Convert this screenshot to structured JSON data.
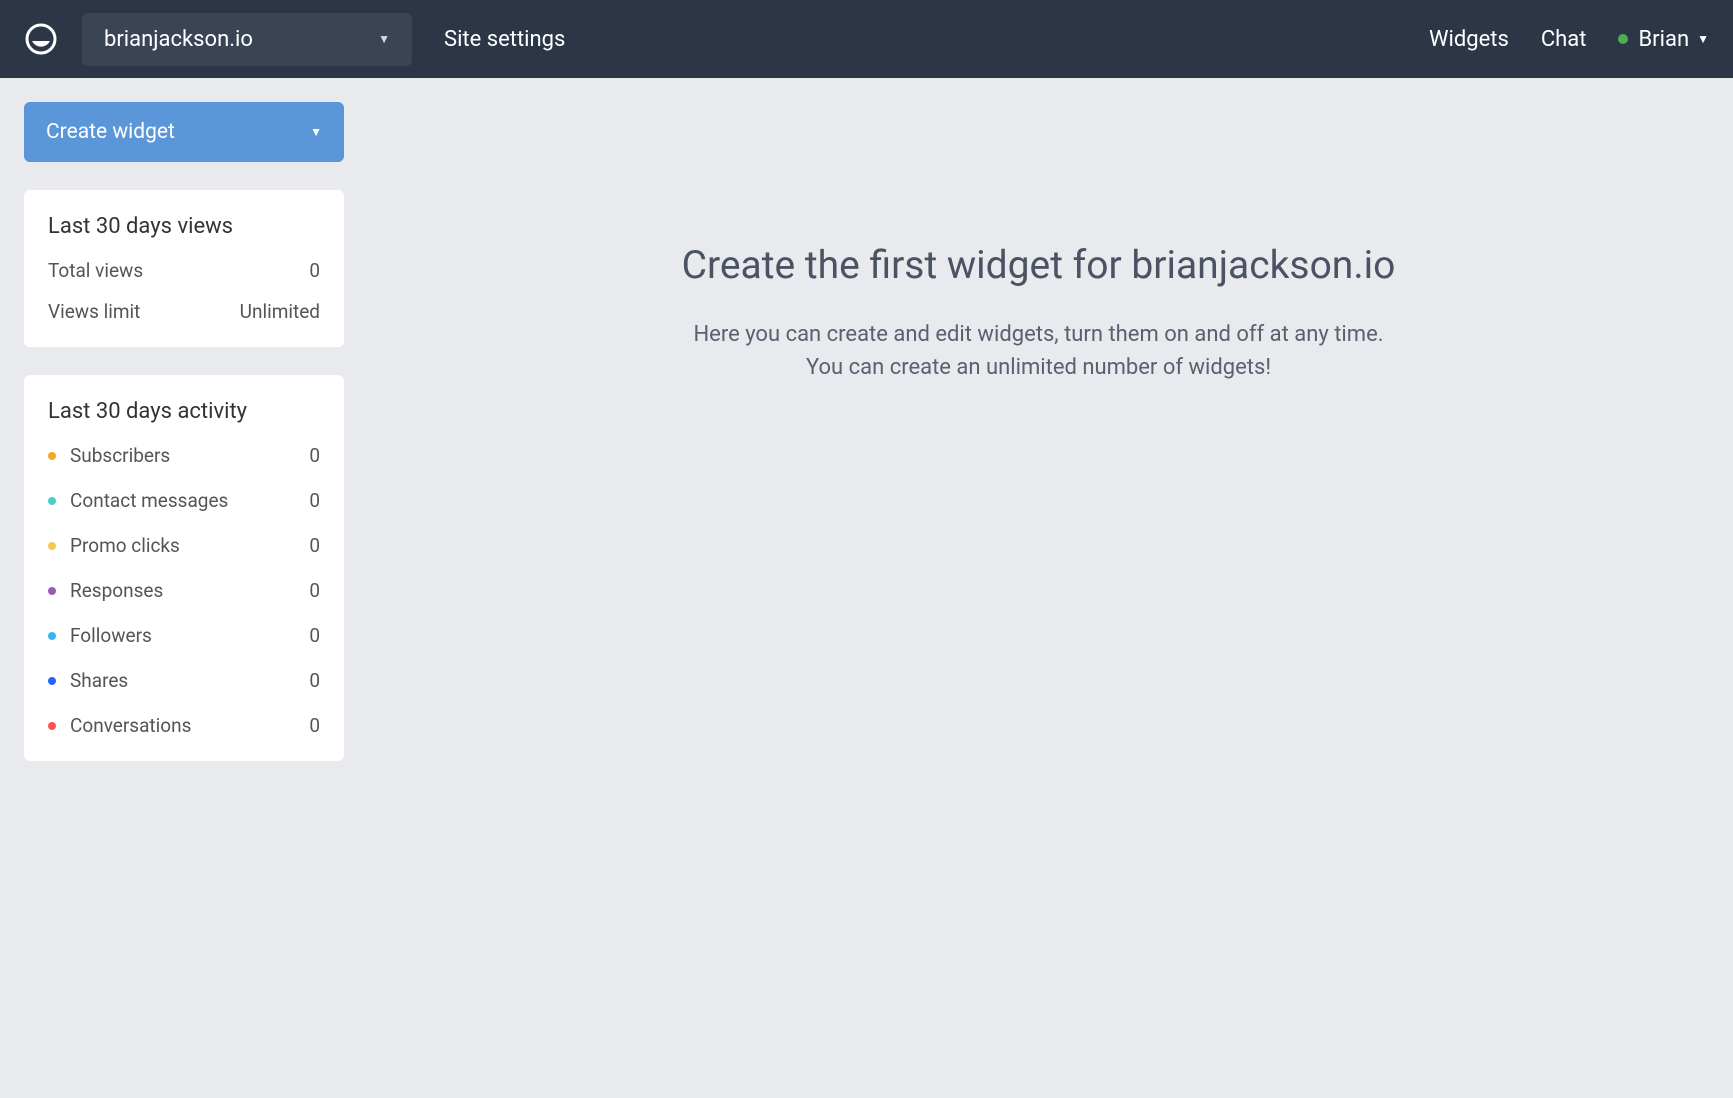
{
  "header": {
    "site_name": "brianjackson.io",
    "nav": {
      "site_settings": "Site settings",
      "widgets": "Widgets",
      "chat": "Chat"
    },
    "user": {
      "name": "Brian"
    }
  },
  "sidebar": {
    "create_widget_label": "Create widget",
    "views_card": {
      "title": "Last 30 days views",
      "total_views_label": "Total views",
      "total_views_value": "0",
      "views_limit_label": "Views limit",
      "views_limit_value": "Unlimited"
    },
    "activity_card": {
      "title": "Last 30 days activity",
      "items": [
        {
          "label": "Subscribers",
          "value": "0",
          "color": "#f5a623"
        },
        {
          "label": "Contact messages",
          "value": "0",
          "color": "#4ecdc4"
        },
        {
          "label": "Promo clicks",
          "value": "0",
          "color": "#f7c948"
        },
        {
          "label": "Responses",
          "value": "0",
          "color": "#9b59b6"
        },
        {
          "label": "Followers",
          "value": "0",
          "color": "#3bb4f2"
        },
        {
          "label": "Shares",
          "value": "0",
          "color": "#2962ff"
        },
        {
          "label": "Conversations",
          "value": "0",
          "color": "#ff5252"
        }
      ]
    }
  },
  "main": {
    "heading": "Create the first widget for brianjackson.io",
    "subtext_line1": "Here you can create and edit widgets, turn them on and off at any time.",
    "subtext_line2": "You can create an unlimited number of widgets!"
  }
}
